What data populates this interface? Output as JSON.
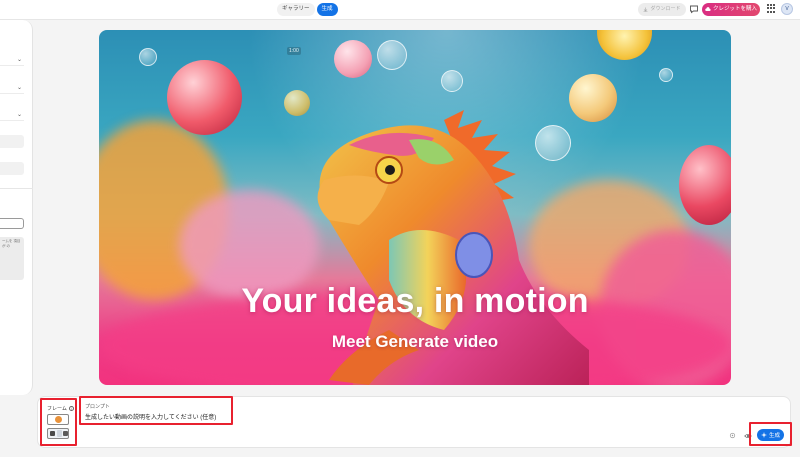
{
  "topbar": {
    "tabs": [
      {
        "label": "ギャラリー",
        "active": false
      },
      {
        "label": "生成",
        "active": true
      }
    ],
    "download_label": "ダウンロード",
    "buy_credits_label": "クレジットを購入",
    "avatar_initial": "V"
  },
  "left_panel": {
    "note_text": "ームを 項目が の"
  },
  "hero": {
    "timestamp": "1:00",
    "title": "Your ideas, in motion",
    "subtitle": "Meet Generate video"
  },
  "bottom_panel": {
    "frame_label": "フレーム",
    "prompt_label": "プロンプト",
    "prompt_placeholder": "生成したい動画の説明を入力してください (任意)",
    "generate_label": "生成"
  },
  "colors": {
    "accent": "#1473e6",
    "buy_button": "#d92d82",
    "highlight": "#e8212f"
  }
}
